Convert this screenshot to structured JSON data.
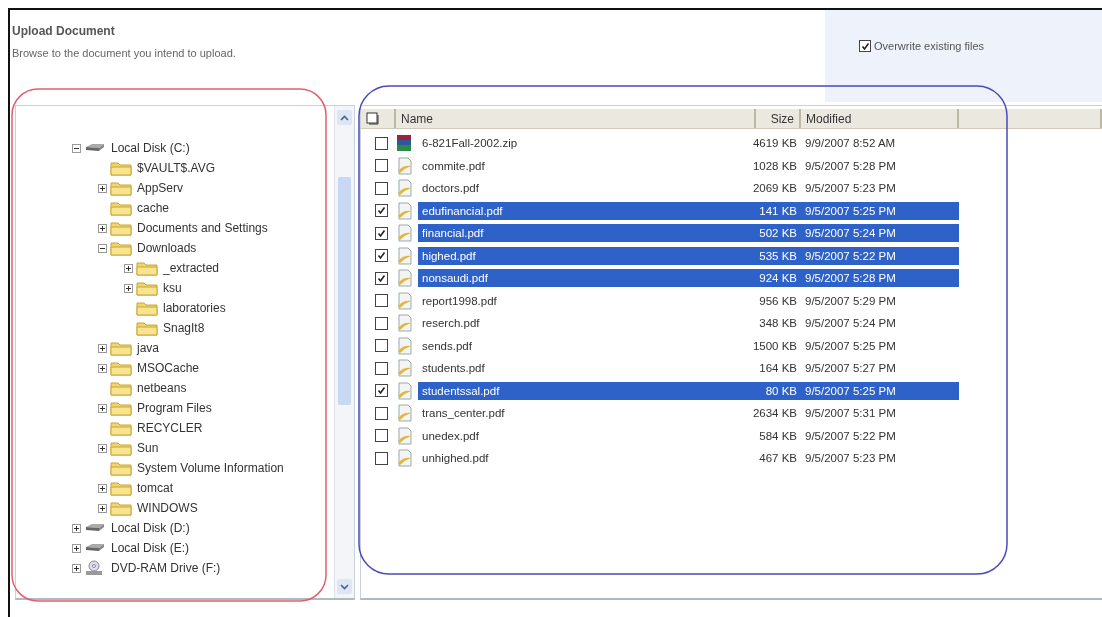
{
  "header": {
    "title": "Upload Document",
    "subtitle": "Browse to the document you intend to upload.",
    "overwrite": {
      "label": "Overwrite existing files",
      "checked": true
    }
  },
  "tree": [
    {
      "kind": "drive",
      "label": "Local Disk (C:)",
      "expanded": true,
      "children": [
        {
          "kind": "folder",
          "label": "$VAULT$.AVG"
        },
        {
          "kind": "folder",
          "label": "AppServ",
          "expanded": false
        },
        {
          "kind": "folder",
          "label": "cache"
        },
        {
          "kind": "folder",
          "label": "Documents and Settings",
          "expanded": false
        },
        {
          "kind": "folder",
          "label": "Downloads",
          "expanded": true,
          "children": [
            {
              "kind": "folder",
              "label": "_extracted",
              "expanded": false
            },
            {
              "kind": "folder",
              "label": "ksu",
              "expanded": false
            },
            {
              "kind": "folder",
              "label": "laboratories"
            },
            {
              "kind": "folder",
              "label": "SnagIt8"
            }
          ]
        },
        {
          "kind": "folder",
          "label": "java",
          "expanded": false
        },
        {
          "kind": "folder",
          "label": "MSOCache",
          "expanded": false
        },
        {
          "kind": "folder",
          "label": "netbeans"
        },
        {
          "kind": "folder",
          "label": "Program Files",
          "expanded": false
        },
        {
          "kind": "folder",
          "label": "RECYCLER"
        },
        {
          "kind": "folder",
          "label": "Sun",
          "expanded": false
        },
        {
          "kind": "folder",
          "label": "System Volume Information"
        },
        {
          "kind": "folder",
          "label": "tomcat",
          "expanded": false
        },
        {
          "kind": "folder",
          "label": "WINDOWS",
          "expanded": false
        }
      ]
    },
    {
      "kind": "drive",
      "label": "Local Disk (D:)",
      "expanded": false
    },
    {
      "kind": "drive",
      "label": "Local Disk (E:)",
      "expanded": false
    },
    {
      "kind": "dvd",
      "label": "DVD-RAM Drive (F:)",
      "expanded": false
    }
  ],
  "files": {
    "columns": [
      "Name",
      "Size",
      "Modified"
    ],
    "rows": [
      {
        "kind": "zip",
        "name": "6-821Fall-2002.zip",
        "size": "4619 KB",
        "modified": "9/9/2007 8:52 AM",
        "checked": false,
        "selected": false
      },
      {
        "kind": "pdf",
        "name": "commite.pdf",
        "size": "1028 KB",
        "modified": "9/5/2007 5:28 PM",
        "checked": false,
        "selected": false
      },
      {
        "kind": "pdf",
        "name": "doctors.pdf",
        "size": "2069 KB",
        "modified": "9/5/2007 5:23 PM",
        "checked": false,
        "selected": false
      },
      {
        "kind": "pdf",
        "name": "edufinancial.pdf",
        "size": "141 KB",
        "modified": "9/5/2007 5:25 PM",
        "checked": true,
        "selected": true
      },
      {
        "kind": "pdf",
        "name": "financial.pdf",
        "size": "502 KB",
        "modified": "9/5/2007 5:24 PM",
        "checked": true,
        "selected": true
      },
      {
        "kind": "pdf",
        "name": "highed.pdf",
        "size": "535 KB",
        "modified": "9/5/2007 5:22 PM",
        "checked": true,
        "selected": true
      },
      {
        "kind": "pdf",
        "name": "nonsaudi.pdf",
        "size": "924 KB",
        "modified": "9/5/2007 5:28 PM",
        "checked": true,
        "selected": true
      },
      {
        "kind": "pdf",
        "name": "report1998.pdf",
        "size": "956 KB",
        "modified": "9/5/2007 5:29 PM",
        "checked": false,
        "selected": false
      },
      {
        "kind": "pdf",
        "name": "reserch.pdf",
        "size": "348 KB",
        "modified": "9/5/2007 5:24 PM",
        "checked": false,
        "selected": false
      },
      {
        "kind": "pdf",
        "name": "sends.pdf",
        "size": "1500 KB",
        "modified": "9/5/2007 5:25 PM",
        "checked": false,
        "selected": false
      },
      {
        "kind": "pdf",
        "name": "students.pdf",
        "size": "164 KB",
        "modified": "9/5/2007 5:27 PM",
        "checked": false,
        "selected": false
      },
      {
        "kind": "pdf",
        "name": "studentssal.pdf",
        "size": "80 KB",
        "modified": "9/5/2007 5:25 PM",
        "checked": true,
        "selected": true
      },
      {
        "kind": "pdf",
        "name": "trans_center.pdf",
        "size": "2634 KB",
        "modified": "9/5/2007 5:31 PM",
        "checked": false,
        "selected": false
      },
      {
        "kind": "pdf",
        "name": "unedex.pdf",
        "size": "584 KB",
        "modified": "9/5/2007 5:22 PM",
        "checked": false,
        "selected": false
      },
      {
        "kind": "pdf",
        "name": "unhighed.pdf",
        "size": "467 KB",
        "modified": "9/5/2007 5:23 PM",
        "checked": false,
        "selected": false
      }
    ]
  },
  "annotations": [
    {
      "color": "#e0606e"
    },
    {
      "color": "#4a4ab8"
    }
  ]
}
